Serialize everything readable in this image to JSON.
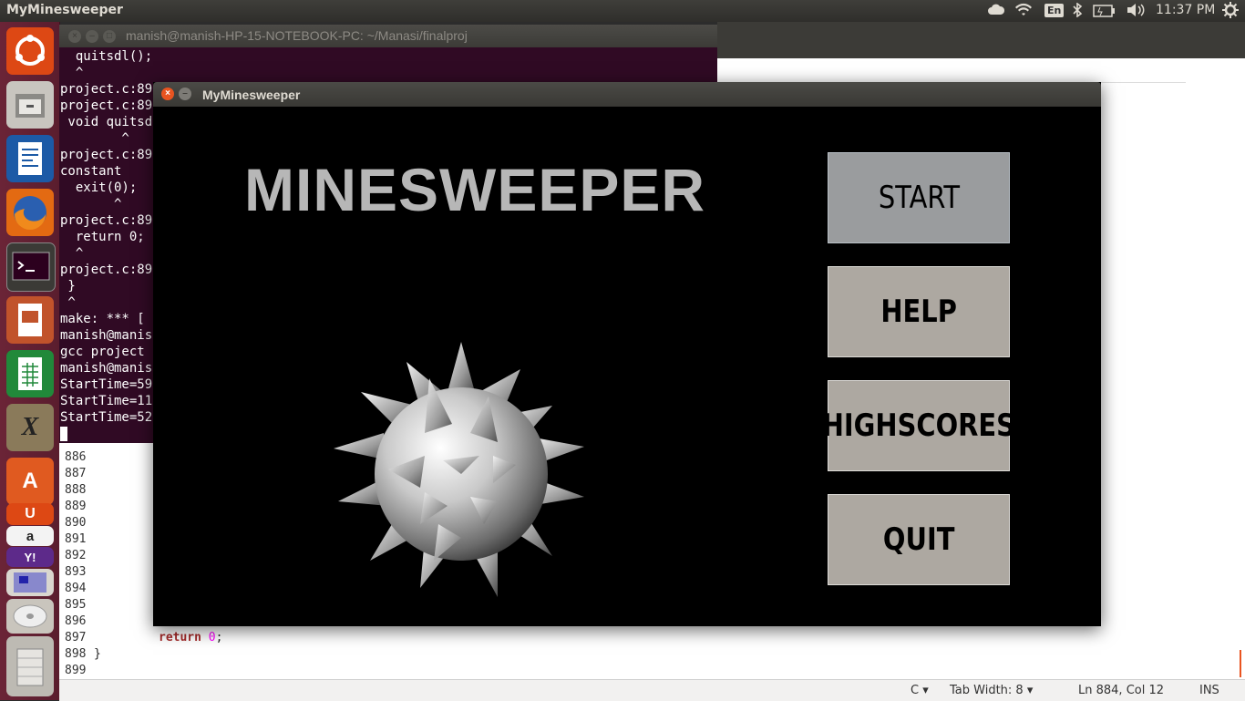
{
  "top_panel": {
    "app_title": "MyMinesweeper",
    "keyboard_layout": "En",
    "time": "11:37 PM"
  },
  "terminal": {
    "title": "manish@manish-HP-15-NOTEBOOK-PC: ~/Manasi/finalproj",
    "lines": [
      "  quitsdl();",
      "  ^",
      "project.c:89",
      "project.c:89",
      " void quitsd",
      "        ^",
      "project.c:89",
      "constant",
      "  exit(0);",
      "       ^",
      "project.c:89",
      "  return 0;",
      "  ^",
      "project.c:89",
      " }",
      " ^",
      "make: *** [",
      "manish@manis",
      "gcc project",
      "manish@manis",
      "StartTime=59",
      "StartTime=11",
      "StartTime=52"
    ]
  },
  "editor": {
    "line_numbers": [
      "886",
      "887",
      "888",
      "889",
      "890",
      "891",
      "892",
      "893",
      "894",
      "895",
      "896",
      "897",
      "898",
      "899"
    ],
    "code": {
      "return_kw": "return",
      "return_val": "0",
      "return_semi": ";",
      "closing_brace": "}"
    },
    "status": {
      "language": "C ▾",
      "tab_width": "Tab Width: 8 ▾",
      "position": "Ln 884, Col 12",
      "mode": "INS"
    }
  },
  "game_window": {
    "title": "MyMinesweeper",
    "heading": "MINESWEEPER",
    "buttons": {
      "start": "START",
      "help": "HELP",
      "highscores": "HIGHSCORES",
      "quit": "QUIT"
    }
  },
  "launcher": {
    "items": [
      "ubuntu-dash-icon",
      "files-icon",
      "writer-icon",
      "firefox-icon",
      "terminal-icon",
      "impress-icon",
      "calc-icon",
      "xfig-icon",
      "software-center-icon",
      "ubuntu-one-icon",
      "amazon-icon",
      "yahoo-mail-icon",
      "workspaces-icon",
      "dvd-icon",
      "trash-icon"
    ]
  },
  "colors": {
    "launcher": "#6b2437",
    "terminal_bg": "#300a24",
    "accent": "#e95420",
    "button_grey": "#ada8a1",
    "start_button": "#9a9c9e"
  }
}
